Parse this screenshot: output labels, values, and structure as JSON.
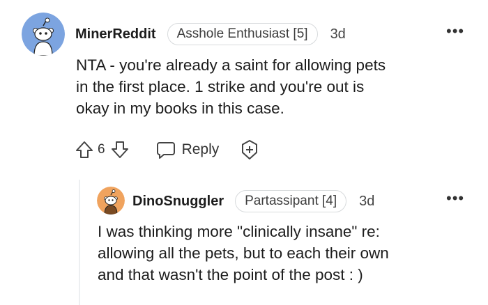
{
  "comments": [
    {
      "username": "MinerReddit",
      "flair": "Asshole Enthusiast [5]",
      "age": "3d",
      "body": [
        "NTA - you're already a saint for allowing pets",
        "in the first place. 1 strike and you're out is",
        "okay in my books in this case."
      ],
      "votes": "6",
      "reply_label": "Reply",
      "avatar_color": "#7ca4e0"
    },
    {
      "username": "DinoSnuggler",
      "flair": "Partassipant [4]",
      "age": "3d",
      "body": [
        "I was thinking more \"clinically insane\" re:",
        "allowing all the pets, but to each their own",
        "and that wasn't the point of the post : )"
      ],
      "avatar_color": "#f0a35e"
    }
  ],
  "icons": [
    "upvote-icon",
    "downvote-icon",
    "comment-icon",
    "award-icon",
    "more-options-icon"
  ]
}
